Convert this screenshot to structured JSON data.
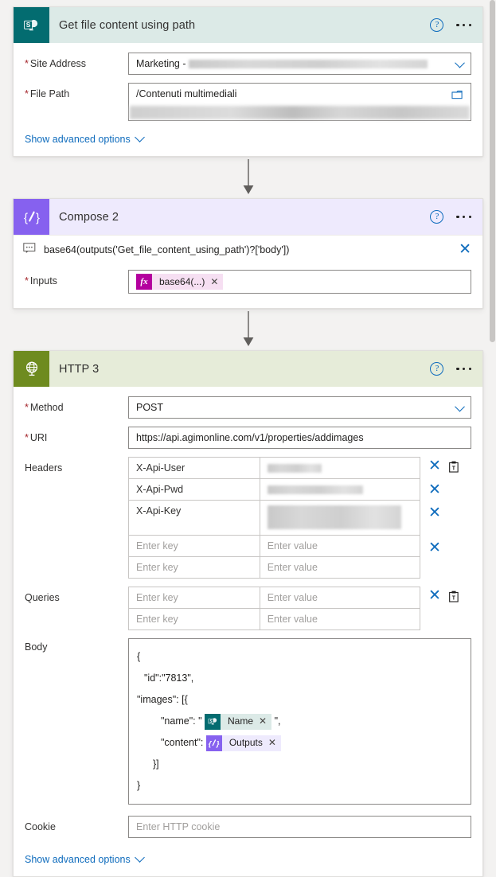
{
  "flow": {
    "cards": [
      {
        "id": "get-file-content",
        "title": "Get file content using path",
        "connector": "sharepoint",
        "icon": "sharepoint-icon",
        "header_color": "#dceae7",
        "icon_color": "#036c70",
        "fields": {
          "site_address": {
            "label": "Site Address",
            "required": true,
            "value": "Marketing -",
            "redacted": true
          },
          "file_path": {
            "label": "File Path",
            "required": true,
            "value": "/Contenuti multimediali",
            "redacted_second_line": true
          }
        },
        "advanced_label": "Show advanced options"
      },
      {
        "id": "compose-2",
        "title": "Compose 2",
        "connector": "compose",
        "icon": "compose-icon",
        "header_color": "#eeeafd",
        "icon_color": "#8661ef",
        "expression": "base64(outputs('Get_file_content_using_path')?['body'])",
        "fields": {
          "inputs": {
            "label": "Inputs",
            "required": true,
            "token_label": "base64(...)",
            "token_badge": "fx"
          }
        }
      },
      {
        "id": "http-3",
        "title": "HTTP 3",
        "connector": "http",
        "icon": "globe-icon",
        "header_color": "#e6ecd9",
        "icon_color": "#6e8b1f",
        "fields": {
          "method": {
            "label": "Method",
            "required": true,
            "value": "POST"
          },
          "uri": {
            "label": "URI",
            "required": true,
            "value": "https://api.agimonline.com/v1/properties/addimages"
          },
          "headers": {
            "label": "Headers",
            "rows": [
              {
                "key": "X-Api-User",
                "value": "",
                "redacted": true,
                "redact_width": 68,
                "removable": true
              },
              {
                "key": "X-Api-Pwd",
                "value": "",
                "redacted": true,
                "redact_width": 120,
                "removable": true
              },
              {
                "key": "X-Api-Key",
                "value": "",
                "redacted": true,
                "redact_width": 168,
                "redact_tall": true,
                "removable": true
              },
              {
                "key": "",
                "value": "",
                "key_placeholder": "Enter key",
                "value_placeholder": "Enter value",
                "removable": true
              },
              {
                "key": "",
                "value": "",
                "key_placeholder": "Enter key",
                "value_placeholder": "Enter value",
                "removable": false
              }
            ]
          },
          "queries": {
            "label": "Queries",
            "rows": [
              {
                "key": "",
                "value": "",
                "key_placeholder": "Enter key",
                "value_placeholder": "Enter value",
                "removable": true
              },
              {
                "key": "",
                "value": "",
                "key_placeholder": "Enter key",
                "value_placeholder": "Enter value",
                "removable": false
              }
            ]
          },
          "body": {
            "label": "Body",
            "lines": [
              "{",
              "\"id\":\"7813\",",
              "\"images\": [{",
              "\"name\": \"",
              "\"content\":",
              "}]",
              "}"
            ],
            "name_suffix": "\",",
            "tokens": {
              "name": {
                "label": "Name",
                "badge": "sharepoint-icon"
              },
              "outputs": {
                "label": "Outputs",
                "badge": "compose-icon"
              }
            }
          },
          "cookie": {
            "label": "Cookie",
            "placeholder": "Enter HTTP cookie",
            "value": ""
          }
        },
        "advanced_label": "Show advanced options"
      }
    ],
    "icons": {
      "help": "help-icon",
      "more": "more-options-icon",
      "remove": "remove-icon",
      "clipboard": "switch-to-text-mode-icon",
      "folder": "folder-picker-icon",
      "comment": "expression-tooltip-icon",
      "chevron": "chevron-down-icon"
    }
  }
}
